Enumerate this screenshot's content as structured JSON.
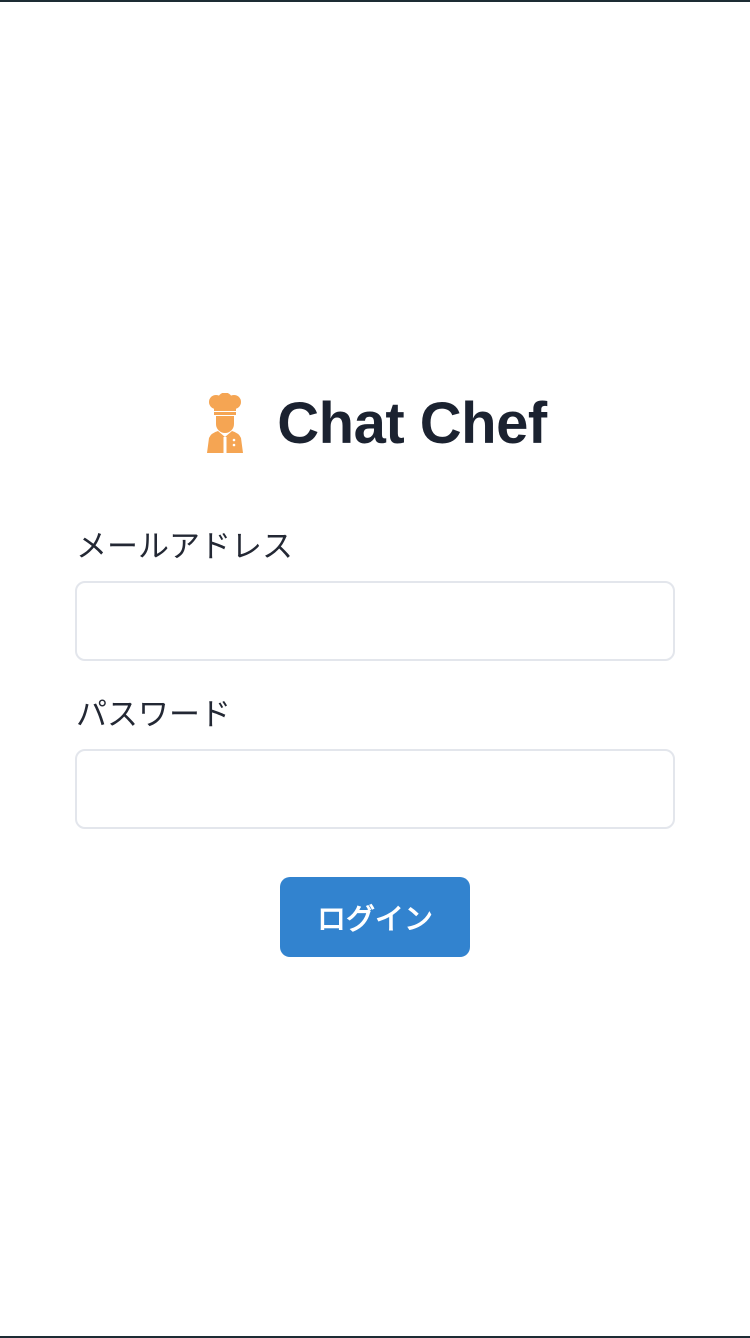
{
  "app": {
    "title": "Chat Chef",
    "icon": "chef-icon",
    "icon_color": "#f5a553"
  },
  "form": {
    "email": {
      "label": "メールアドレス",
      "value": "",
      "placeholder": ""
    },
    "password": {
      "label": "パスワード",
      "value": "",
      "placeholder": ""
    },
    "submit_label": "ログイン"
  },
  "colors": {
    "primary": "#3283cf",
    "text": "#1b2230",
    "input_border": "#e3e6ec",
    "frame_line": "#1d2c34"
  }
}
